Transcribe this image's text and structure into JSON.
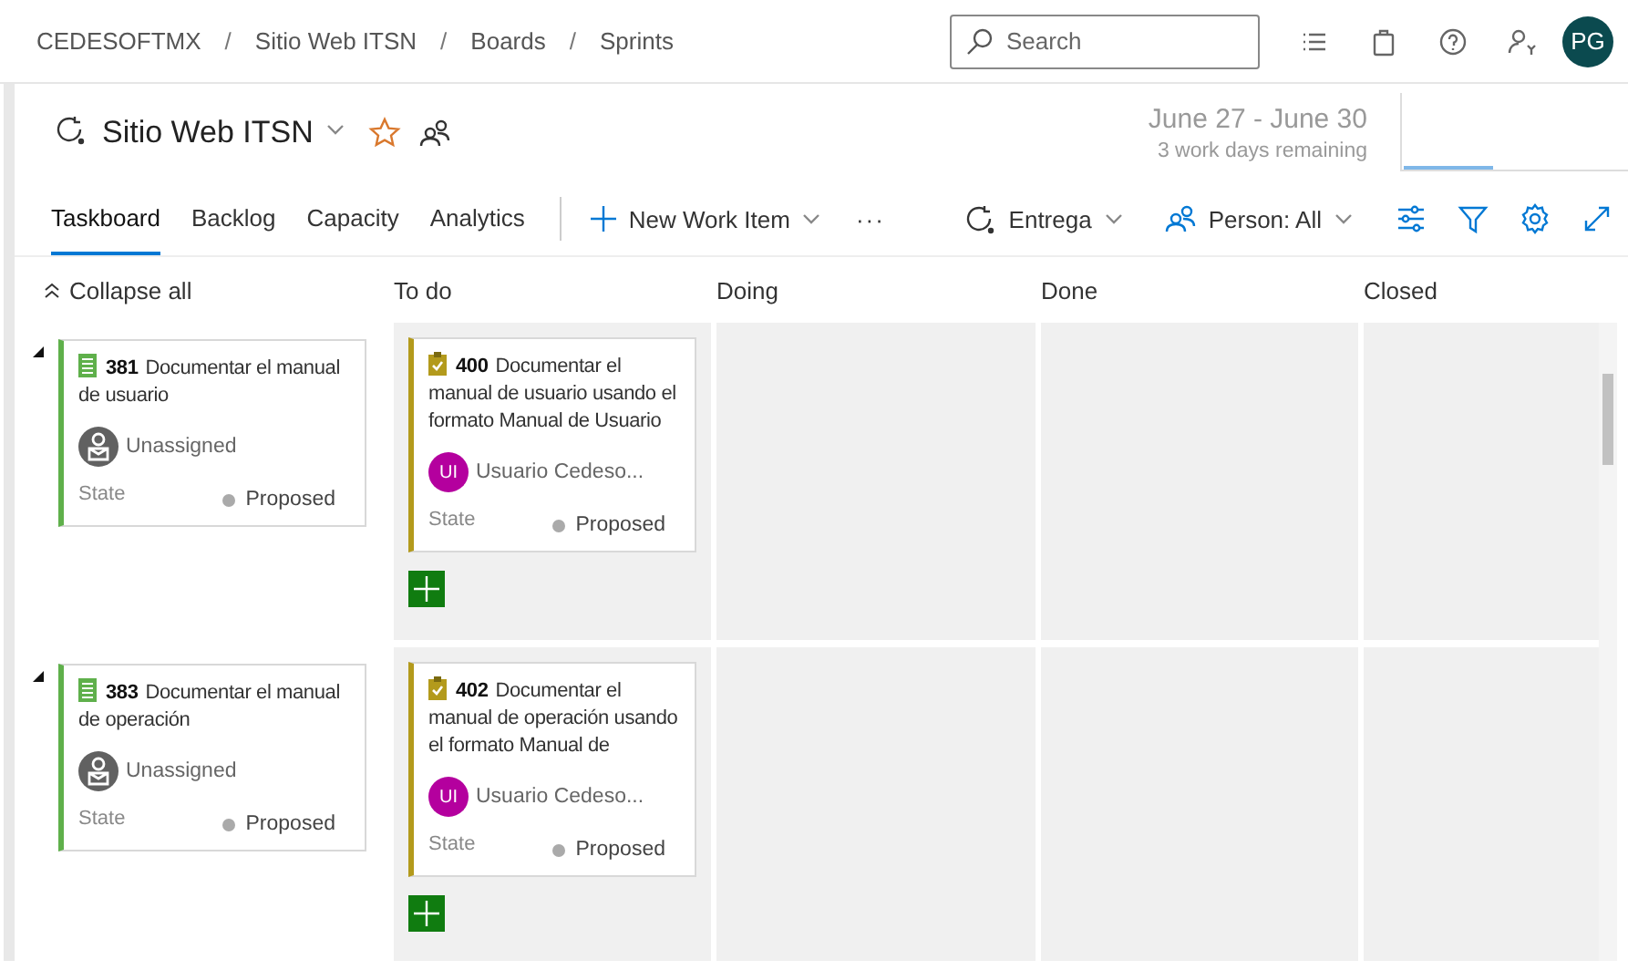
{
  "breadcrumbs": [
    "CEDESOFTMX",
    "Sitio Web ITSN",
    "Boards",
    "Sprints"
  ],
  "breadcrumb_separators": [
    "/",
    "/",
    "/"
  ],
  "search": {
    "placeholder": "Search"
  },
  "user": {
    "initials": "PG"
  },
  "sprint": {
    "name": "Sitio Web ITSN",
    "favorite": false,
    "dates": "June 27 - June 30",
    "remaining": "3 work days remaining"
  },
  "tabs": [
    {
      "label": "Taskboard",
      "selected": true
    },
    {
      "label": "Backlog",
      "selected": false
    },
    {
      "label": "Capacity",
      "selected": false
    },
    {
      "label": "Analytics",
      "selected": false
    }
  ],
  "new_item": "New Work Item",
  "more": "···",
  "filters": [
    {
      "kind": "iteration",
      "label": "Entrega"
    },
    {
      "kind": "person",
      "label": "Person: All"
    }
  ],
  "collapse_all": "Collapse all",
  "columns": [
    "To do",
    "Doing",
    "Done",
    "Closed"
  ],
  "rows": [
    {
      "expanded": true,
      "parent": {
        "kind": "backlog",
        "id": "381",
        "title": "Documentar el manual de usuario",
        "assignee": "Unassigned",
        "state_label": "State",
        "state": "Proposed"
      },
      "tasks": [
        {
          "kind": "task",
          "id": "400",
          "title": "Documentar el manual de usuario usando el formato Manual de Usuario",
          "initials": "UI",
          "assignee": "Usuario Cedeso...",
          "state_label": "State",
          "state": "Proposed"
        }
      ]
    },
    {
      "expanded": true,
      "parent": {
        "kind": "backlog",
        "id": "383",
        "title": "Documentar el manual de operación",
        "assignee": "Unassigned",
        "state_label": "State",
        "state": "Proposed"
      },
      "tasks": [
        {
          "kind": "task",
          "id": "402",
          "title": "Documentar el manual de operación usando el formato Manual de",
          "initials": "UI",
          "assignee": "Usuario Cedeso...",
          "state_label": "State",
          "state": "Proposed"
        }
      ]
    }
  ]
}
